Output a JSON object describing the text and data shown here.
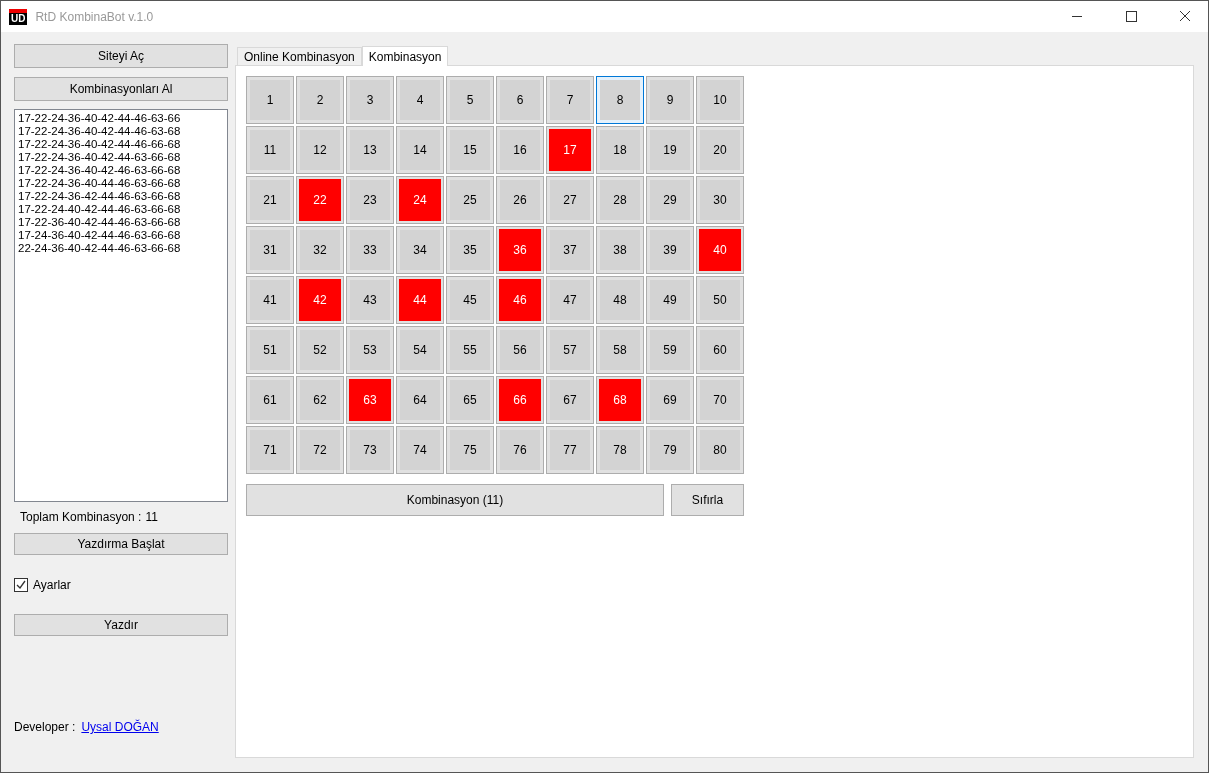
{
  "window": {
    "logo": "UD",
    "title": "RtD KombinaBot v.1.0"
  },
  "sidebar": {
    "open_site_button": "Siteyi Aç",
    "get_button": "Kombinasyonları Al",
    "combinations": [
      "17-22-24-36-40-42-44-46-63-66",
      "17-22-24-36-40-42-44-46-63-68",
      "17-22-24-36-40-42-44-46-66-68",
      "17-22-24-36-40-42-44-63-66-68",
      "17-22-24-36-40-42-46-63-66-68",
      "17-22-24-36-40-44-46-63-66-68",
      "17-22-24-36-42-44-46-63-66-68",
      "17-22-24-40-42-44-46-63-66-68",
      "17-22-36-40-42-44-46-63-66-68",
      "17-24-36-40-42-44-46-63-66-68",
      "22-24-36-40-42-44-46-63-66-68"
    ],
    "total_label": "Toplam Kombinasyon :",
    "total_value": "11",
    "print_start_button": "Yazdırma Başlat",
    "settings": {
      "label": "Ayarlar",
      "checked": true
    },
    "print_button": "Yazdır",
    "developer_label": "Developer :",
    "developer_link": "Uysal DOĞAN"
  },
  "tabs": [
    {
      "label": "Online Kombinasyon",
      "selected": false
    },
    {
      "label": "Kombinasyon",
      "selected": true
    }
  ],
  "cells": [
    {
      "number": "1",
      "selected": false,
      "focused": false
    },
    {
      "number": "2",
      "selected": false,
      "focused": false
    },
    {
      "number": "3",
      "selected": false,
      "focused": false
    },
    {
      "number": "4",
      "selected": false,
      "focused": false
    },
    {
      "number": "5",
      "selected": false,
      "focused": false
    },
    {
      "number": "6",
      "selected": false,
      "focused": false
    },
    {
      "number": "7",
      "selected": false,
      "focused": false
    },
    {
      "number": "8",
      "selected": false,
      "focused": true
    },
    {
      "number": "9",
      "selected": false,
      "focused": false
    },
    {
      "number": "10",
      "selected": false,
      "focused": false
    },
    {
      "number": "11",
      "selected": false,
      "focused": false
    },
    {
      "number": "12",
      "selected": false,
      "focused": false
    },
    {
      "number": "13",
      "selected": false,
      "focused": false
    },
    {
      "number": "14",
      "selected": false,
      "focused": false
    },
    {
      "number": "15",
      "selected": false,
      "focused": false
    },
    {
      "number": "16",
      "selected": false,
      "focused": false
    },
    {
      "number": "17",
      "selected": true,
      "focused": false
    },
    {
      "number": "18",
      "selected": false,
      "focused": false
    },
    {
      "number": "19",
      "selected": false,
      "focused": false
    },
    {
      "number": "20",
      "selected": false,
      "focused": false
    },
    {
      "number": "21",
      "selected": false,
      "focused": false
    },
    {
      "number": "22",
      "selected": true,
      "focused": false
    },
    {
      "number": "23",
      "selected": false,
      "focused": false
    },
    {
      "number": "24",
      "selected": true,
      "focused": false
    },
    {
      "number": "25",
      "selected": false,
      "focused": false
    },
    {
      "number": "26",
      "selected": false,
      "focused": false
    },
    {
      "number": "27",
      "selected": false,
      "focused": false
    },
    {
      "number": "28",
      "selected": false,
      "focused": false
    },
    {
      "number": "29",
      "selected": false,
      "focused": false
    },
    {
      "number": "30",
      "selected": false,
      "focused": false
    },
    {
      "number": "31",
      "selected": false,
      "focused": false
    },
    {
      "number": "32",
      "selected": false,
      "focused": false
    },
    {
      "number": "33",
      "selected": false,
      "focused": false
    },
    {
      "number": "34",
      "selected": false,
      "focused": false
    },
    {
      "number": "35",
      "selected": false,
      "focused": false
    },
    {
      "number": "36",
      "selected": true,
      "focused": false
    },
    {
      "number": "37",
      "selected": false,
      "focused": false
    },
    {
      "number": "38",
      "selected": false,
      "focused": false
    },
    {
      "number": "39",
      "selected": false,
      "focused": false
    },
    {
      "number": "40",
      "selected": true,
      "focused": false
    },
    {
      "number": "41",
      "selected": false,
      "focused": false
    },
    {
      "number": "42",
      "selected": true,
      "focused": false
    },
    {
      "number": "43",
      "selected": false,
      "focused": false
    },
    {
      "number": "44",
      "selected": true,
      "focused": false
    },
    {
      "number": "45",
      "selected": false,
      "focused": false
    },
    {
      "number": "46",
      "selected": true,
      "focused": false
    },
    {
      "number": "47",
      "selected": false,
      "focused": false
    },
    {
      "number": "48",
      "selected": false,
      "focused": false
    },
    {
      "number": "49",
      "selected": false,
      "focused": false
    },
    {
      "number": "50",
      "selected": false,
      "focused": false
    },
    {
      "number": "51",
      "selected": false,
      "focused": false
    },
    {
      "number": "52",
      "selected": false,
      "focused": false
    },
    {
      "number": "53",
      "selected": false,
      "focused": false
    },
    {
      "number": "54",
      "selected": false,
      "focused": false
    },
    {
      "number": "55",
      "selected": false,
      "focused": false
    },
    {
      "number": "56",
      "selected": false,
      "focused": false
    },
    {
      "number": "57",
      "selected": false,
      "focused": false
    },
    {
      "number": "58",
      "selected": false,
      "focused": false
    },
    {
      "number": "59",
      "selected": false,
      "focused": false
    },
    {
      "number": "60",
      "selected": false,
      "focused": false
    },
    {
      "number": "61",
      "selected": false,
      "focused": false
    },
    {
      "number": "62",
      "selected": false,
      "focused": false
    },
    {
      "number": "63",
      "selected": true,
      "focused": false
    },
    {
      "number": "64",
      "selected": false,
      "focused": false
    },
    {
      "number": "65",
      "selected": false,
      "focused": false
    },
    {
      "number": "66",
      "selected": true,
      "focused": false
    },
    {
      "number": "67",
      "selected": false,
      "focused": false
    },
    {
      "number": "68",
      "selected": true,
      "focused": false
    },
    {
      "number": "69",
      "selected": false,
      "focused": false
    },
    {
      "number": "70",
      "selected": false,
      "focused": false
    },
    {
      "number": "71",
      "selected": false,
      "focused": false
    },
    {
      "number": "72",
      "selected": false,
      "focused": false
    },
    {
      "number": "73",
      "selected": false,
      "focused": false
    },
    {
      "number": "74",
      "selected": false,
      "focused": false
    },
    {
      "number": "75",
      "selected": false,
      "focused": false
    },
    {
      "number": "76",
      "selected": false,
      "focused": false
    },
    {
      "number": "77",
      "selected": false,
      "focused": false
    },
    {
      "number": "78",
      "selected": false,
      "focused": false
    },
    {
      "number": "79",
      "selected": false,
      "focused": false
    },
    {
      "number": "80",
      "selected": false,
      "focused": false
    }
  ],
  "combine_button": "Kombinasyon (11)",
  "reset_button": "Sıfırla"
}
